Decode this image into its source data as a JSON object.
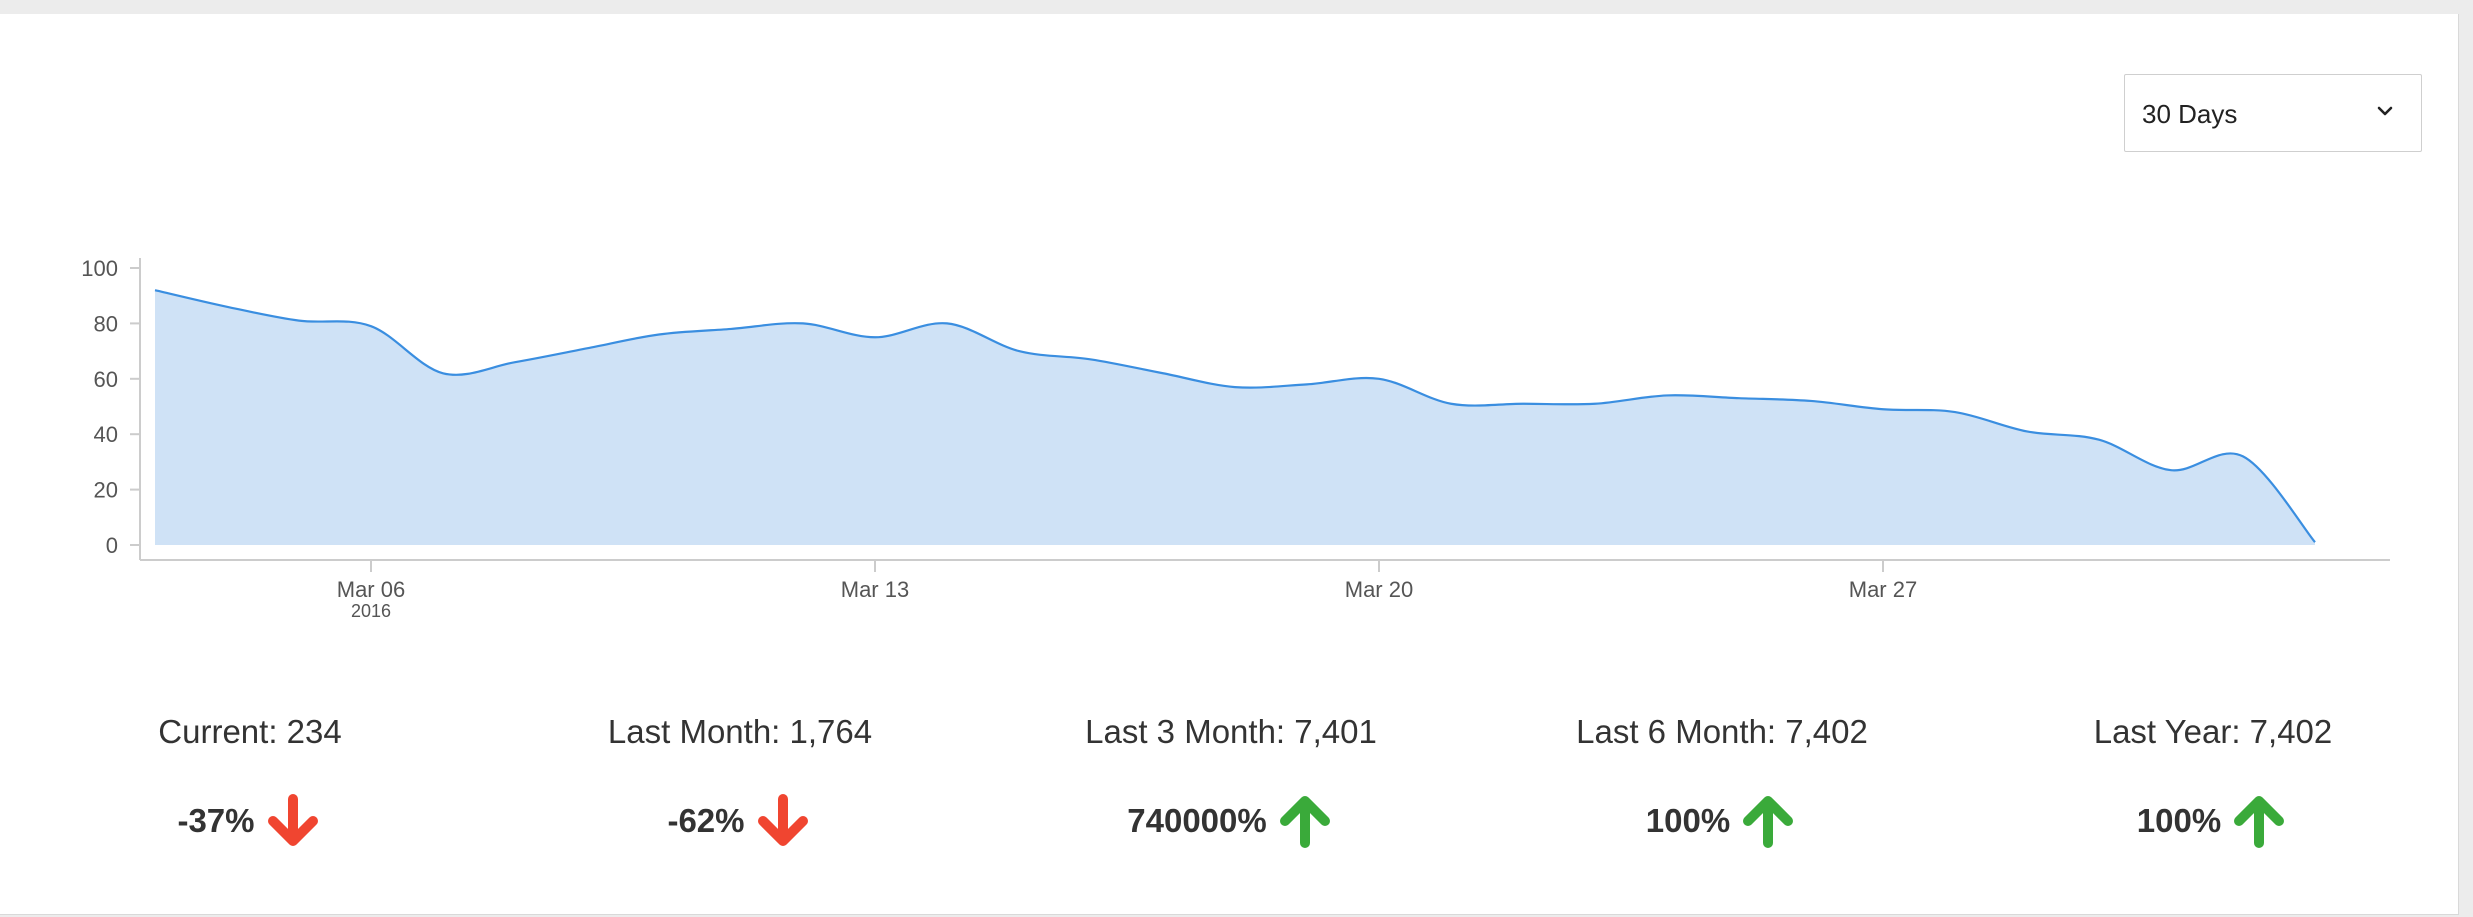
{
  "range_select": {
    "value": "30 Days",
    "icon": "chevron-down-icon"
  },
  "colors": {
    "line": "#3a8ee0",
    "fill": "#cfe2f6",
    "up": "#3aaa3a",
    "down": "#f04530",
    "axis": "#cccccc",
    "text": "#555555"
  },
  "chart_data": {
    "type": "area",
    "title": "",
    "xlabel": "",
    "ylabel": "",
    "ylim": [
      0,
      100
    ],
    "yticks": [
      0,
      20,
      40,
      60,
      80,
      100
    ],
    "xlim": [
      "2016-03-03",
      "2016-04-03"
    ],
    "xticks": [
      {
        "date": "2016-03-06",
        "label": "Mar 06",
        "sublabel": "2016"
      },
      {
        "date": "2016-03-13",
        "label": "Mar 13",
        "sublabel": ""
      },
      {
        "date": "2016-03-20",
        "label": "Mar 20",
        "sublabel": ""
      },
      {
        "date": "2016-03-27",
        "label": "Mar 27",
        "sublabel": ""
      }
    ],
    "grid": false,
    "series": [
      {
        "points": [
          [
            "2016-03-03",
            92
          ],
          [
            "2016-03-04",
            86
          ],
          [
            "2016-03-05",
            81
          ],
          [
            "2016-03-06",
            79
          ],
          [
            "2016-03-07",
            62
          ],
          [
            "2016-03-08",
            66
          ],
          [
            "2016-03-09",
            71
          ],
          [
            "2016-03-10",
            76
          ],
          [
            "2016-03-11",
            78
          ],
          [
            "2016-03-12",
            80
          ],
          [
            "2016-03-13",
            75
          ],
          [
            "2016-03-14",
            80
          ],
          [
            "2016-03-15",
            70
          ],
          [
            "2016-03-16",
            67
          ],
          [
            "2016-03-17",
            62
          ],
          [
            "2016-03-18",
            57
          ],
          [
            "2016-03-19",
            58
          ],
          [
            "2016-03-20",
            60
          ],
          [
            "2016-03-21",
            51
          ],
          [
            "2016-03-22",
            51
          ],
          [
            "2016-03-23",
            51
          ],
          [
            "2016-03-24",
            54
          ],
          [
            "2016-03-25",
            53
          ],
          [
            "2016-03-26",
            52
          ],
          [
            "2016-03-27",
            49
          ],
          [
            "2016-03-28",
            48
          ],
          [
            "2016-03-29",
            41
          ],
          [
            "2016-03-30",
            38
          ],
          [
            "2016-03-31",
            27
          ],
          [
            "2016-04-01",
            32
          ],
          [
            "2016-04-02",
            1
          ]
        ]
      }
    ]
  },
  "stats": [
    {
      "title": "Current: 234",
      "change": "-37%",
      "direction": "down"
    },
    {
      "title": "Last Month: 1,764",
      "change": "-62%",
      "direction": "down"
    },
    {
      "title": "Last 3 Month: 7,401",
      "change": "740000%",
      "direction": "up"
    },
    {
      "title": "Last 6 Month: 7,402",
      "change": "100%",
      "direction": "up"
    },
    {
      "title": "Last Year: 7,402",
      "change": "100%",
      "direction": "up"
    }
  ]
}
